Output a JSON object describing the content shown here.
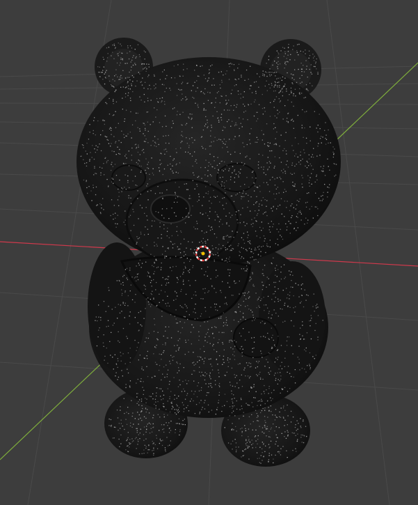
{
  "viewport": {
    "background_color": "#3d3d3d",
    "grid_color": "#4a4a4a",
    "x_axis_color": "#d0394c",
    "y_axis_color": "#7fae3c",
    "model": {
      "body_color": "#161616",
      "point_color": "#b8b8b8",
      "shading": "point-cloud"
    },
    "origin_marker": {
      "icon": "3d-cursor-icon",
      "ring_color_a": "#e23b3b",
      "ring_color_b": "#ffffff",
      "center_color": "#f0c000"
    }
  }
}
